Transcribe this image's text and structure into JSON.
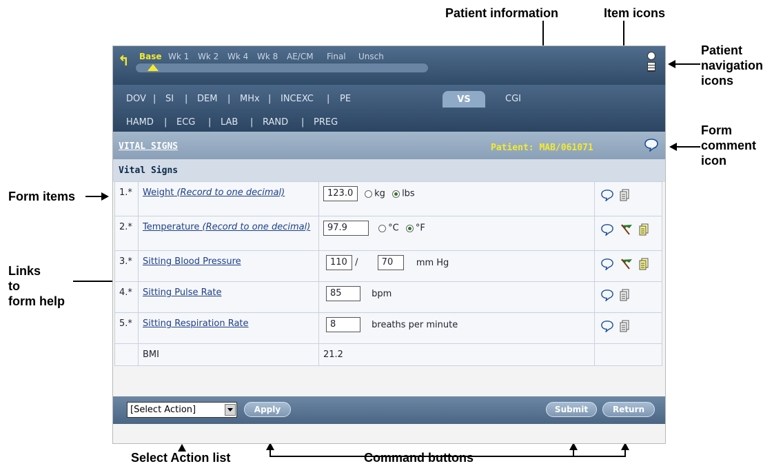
{
  "annotations": {
    "patient_information": "Patient information",
    "item_icons": "Item icons",
    "patient_navigation_icons": "Patient\nnavigation\nicons",
    "form_comment_icon": "Form\ncomment\nicon",
    "form_items": "Form items",
    "links_to_form_help": "Links\nto\nform help",
    "select_action_list": "Select Action list",
    "command_buttons": "Command buttons"
  },
  "visits": [
    "Base",
    "Wk 1",
    "Wk 2",
    "Wk 4",
    "Wk 8",
    "AE/CM",
    "Final",
    "Unsch"
  ],
  "selected_visit": "Base",
  "tabs_row1": [
    "DOV",
    "SI",
    "DEM",
    "MHx",
    "INCEXC",
    "PE",
    "VS",
    "CGI"
  ],
  "tabs_row2": [
    "HAMD",
    "ECG",
    "LAB",
    "RAND",
    "PREG"
  ],
  "selected_tab": "VS",
  "form": {
    "title": "VITAL SIGNS",
    "patient": "Patient: MAB/061071",
    "section": "Vital Signs"
  },
  "items": [
    {
      "num": "1.*",
      "label": "Weight",
      "note": "(Record to one decimal)",
      "value": "123.0",
      "opt1": "kg",
      "opt2": "lbs"
    },
    {
      "num": "2.*",
      "label": "Temperature",
      "note": "(Record to one decimal)",
      "value": "97.9",
      "opt1": "°C",
      "opt2": "°F"
    },
    {
      "num": "3.*",
      "label": "Sitting Blood Pressure",
      "value1": "110",
      "slash": "/",
      "value2": "70",
      "unit": "mm Hg"
    },
    {
      "num": "4.*",
      "label": "Sitting Pulse Rate",
      "value": "85",
      "unit": "bpm"
    },
    {
      "num": "5.*",
      "label": "Sitting Respiration Rate",
      "value": "8",
      "unit": "breaths per minute"
    },
    {
      "num": "",
      "label": "BMI",
      "value": "21.2"
    }
  ],
  "footer": {
    "select_action": "[Select Action]",
    "apply": "Apply",
    "submit": "Submit",
    "return": "Return"
  },
  "icons": [
    "back-arrow-icon",
    "calendar-clock-icon",
    "list-icon",
    "comment-icon",
    "flag-icon",
    "audit-trail-icon"
  ],
  "colors": {
    "selected_visit": "#f4ea2c",
    "patient_text": "#f4ea2c",
    "nav_bg": "#3d5a7a"
  }
}
